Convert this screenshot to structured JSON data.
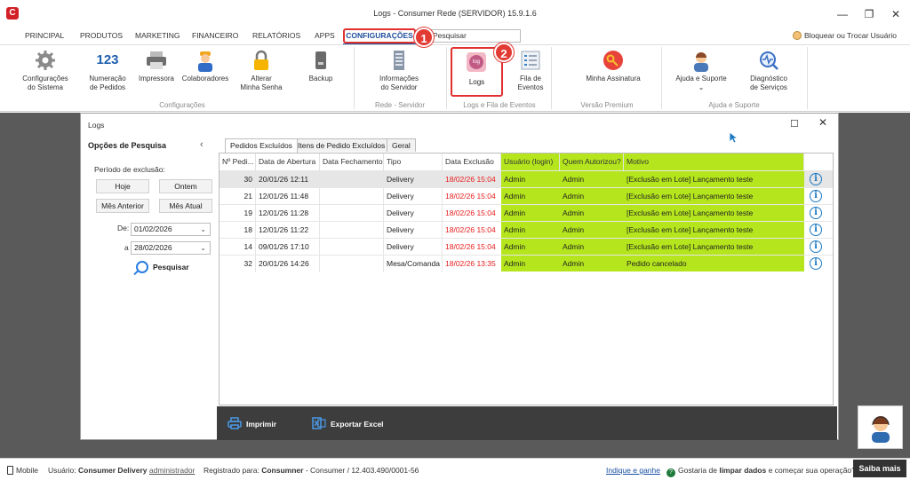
{
  "window": {
    "title": "Logs - Consumer Rede (SERVIDOR) 15.9.1.6"
  },
  "menu": {
    "items": [
      "PRINCIPAL",
      "PRODUTOS",
      "MARKETING",
      "FINANCEIRO",
      "RELATÓRIOS",
      "APPS"
    ],
    "active": "CONFIGURAÇÕES",
    "search_placeholder": "Pesquisar",
    "user_switch": "Bloquear ou Trocar Usuário"
  },
  "badges": [
    "1",
    "2"
  ],
  "ribbon": {
    "buttons": [
      {
        "label1": "Configurações",
        "label2": "do Sistema",
        "icon": "gear-icon"
      },
      {
        "label1": "Numeração",
        "label2": "de Pedidos",
        "icon": "numbers-icon",
        "glyph": "123"
      },
      {
        "label1": "Impressora",
        "label2": "",
        "icon": "printer-icon"
      },
      {
        "label1": "Colaboradores",
        "label2": "",
        "icon": "worker-icon"
      },
      {
        "label1": "Alterar",
        "label2": "Minha Senha",
        "icon": "lock-icon"
      },
      {
        "label1": "Backup",
        "label2": "",
        "icon": "backup-icon"
      },
      {
        "label1": "Informações",
        "label2": "do Servidor",
        "icon": "server-icon"
      },
      {
        "label1": "Logs",
        "label2": "",
        "icon": "logs-icon",
        "glyph": "log"
      },
      {
        "label1": "Fila de",
        "label2": "Eventos",
        "icon": "event-queue-icon"
      },
      {
        "label1": "Minha Assinatura",
        "label2": "",
        "icon": "key-icon"
      },
      {
        "label1": "Ajuda e Suporte",
        "label2": "⌄",
        "icon": "support-icon"
      },
      {
        "label1": "Diagnóstico",
        "label2": "de Serviços",
        "icon": "diagnostic-icon"
      }
    ],
    "groups": [
      "Configurações",
      "Rede - Servidor",
      "Logs e Fila de Eventos",
      "Versão Premium",
      "Ajuda e Suporte"
    ]
  },
  "logs_window": {
    "title": "Logs",
    "sidebar": {
      "title": "Opções de Pesquisa",
      "period_label": "Período de exclusão:",
      "buttons": [
        "Hoje",
        "Ontem",
        "Mês Anterior",
        "Mês Atual"
      ],
      "from_label": "De:",
      "from_value": "01/02/2026",
      "to_label": "a",
      "to_value": "28/02/2026",
      "search_label": "Pesquisar"
    },
    "tabs": [
      "Pedidos Excluídos",
      "Itens de Pedido Excluídos",
      "Geral"
    ],
    "columns": [
      "Nº Pedi...",
      "Data de Abertura",
      "Data Fechamento",
      "Tipo",
      "Data Exclusão",
      "Usuário (login)",
      "Quem Autorizou?",
      "Motivo"
    ],
    "rows": [
      [
        "30",
        "20/01/26 12:11",
        "",
        "Delivery",
        "18/02/26 15:04",
        "Admin",
        "Admin",
        "[Exclusão em Lote] Lançamento teste"
      ],
      [
        "21",
        "12/01/26 11:48",
        "",
        "Delivery",
        "18/02/26 15:04",
        "Admin",
        "Admin",
        "[Exclusão em Lote] Lançamento teste"
      ],
      [
        "19",
        "12/01/26 11:28",
        "",
        "Delivery",
        "18/02/26 15:04",
        "Admin",
        "Admin",
        "[Exclusão em Lote] Lançamento teste"
      ],
      [
        "18",
        "12/01/26 11:22",
        "",
        "Delivery",
        "18/02/26 15:04",
        "Admin",
        "Admin",
        "[Exclusão em Lote] Lançamento teste"
      ],
      [
        "14",
        "09/01/26 17:10",
        "",
        "Delivery",
        "18/02/26 15:04",
        "Admin",
        "Admin",
        "[Exclusão em Lote] Lançamento teste"
      ],
      [
        "32",
        "20/01/26 14:26",
        "",
        "Mesa/Comanda",
        "18/02/26 13:35",
        "Admin",
        "Admin",
        "Pedido cancelado"
      ]
    ],
    "print_label": "Imprimir",
    "export_label": "Exportar Excel"
  },
  "statusbar": {
    "mobile": "Mobile",
    "user_prefix": "Usuário:",
    "user_name": "Consumer Delivery",
    "user_role": "administrador",
    "registered_prefix": "Registrado para:",
    "registered_name": "Consumner",
    "registered_rest": "- Consumer / 12.403.490/0001-56",
    "indique": "Indique e ganhe",
    "question_a": "Gostaria de",
    "question_b": "limpar dados",
    "question_c": "e começar sua operação?",
    "saiba": "Saiba mais"
  },
  "colors": {
    "highlight": "#b5e61d",
    "accent": "#1f4e9c",
    "alert": "#e23b34",
    "red_text": "#e81c1c"
  }
}
